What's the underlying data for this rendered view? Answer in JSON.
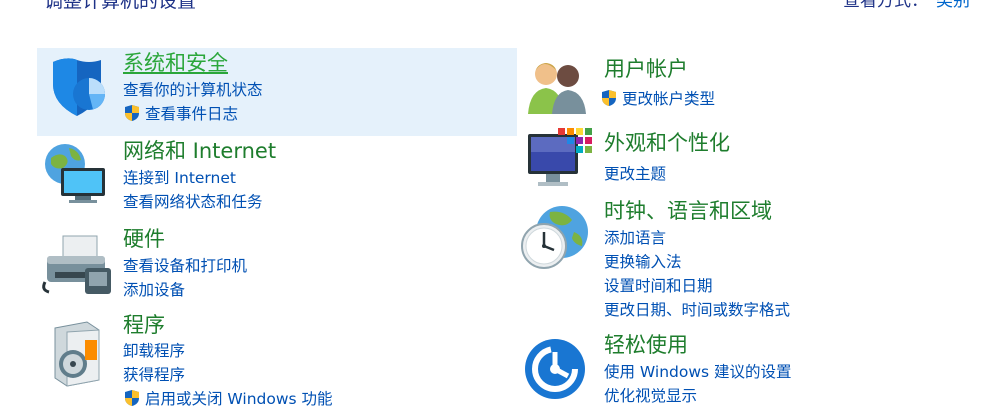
{
  "header": {
    "title": "调整计算机的设置",
    "view_label": "查看方式：",
    "view_value": "类别"
  },
  "categories": [
    {
      "title": "系统和安全",
      "links": [
        {
          "text": "查看你的计算机状态",
          "shield": false
        },
        {
          "text": "查看事件日志",
          "shield": true
        }
      ]
    },
    {
      "title": "网络和 Internet",
      "links": [
        {
          "text": "连接到 Internet",
          "shield": false
        },
        {
          "text": "查看网络状态和任务",
          "shield": false
        }
      ]
    },
    {
      "title": "硬件",
      "links": [
        {
          "text": "查看设备和打印机",
          "shield": false
        },
        {
          "text": "添加设备",
          "shield": false
        }
      ]
    },
    {
      "title": "程序",
      "links": [
        {
          "text": "卸载程序",
          "shield": false
        },
        {
          "text": "获得程序",
          "shield": false
        },
        {
          "text": "启用或关闭 Windows 功能",
          "shield": true
        }
      ]
    },
    {
      "title": "用户帐户",
      "links": [
        {
          "text": "更改帐户类型",
          "shield": true
        }
      ]
    },
    {
      "title": "外观和个性化",
      "links": [
        {
          "text": "更改主题",
          "shield": false
        }
      ]
    },
    {
      "title": "时钟、语言和区域",
      "links": [
        {
          "text": "添加语言",
          "shield": false
        },
        {
          "text": "更换输入法",
          "shield": false
        },
        {
          "text": "设置时间和日期",
          "shield": false
        },
        {
          "text": "更改日期、时间或数字格式",
          "shield": false
        }
      ]
    },
    {
      "title": "轻松使用",
      "links": [
        {
          "text": "使用 Windows 建议的设置",
          "shield": false
        },
        {
          "text": "优化视觉显示",
          "shield": false
        }
      ]
    }
  ],
  "colors": {
    "title_green": "#1e7d2d",
    "link_blue": "#0050b3",
    "highlight": "#e5f1fb"
  }
}
